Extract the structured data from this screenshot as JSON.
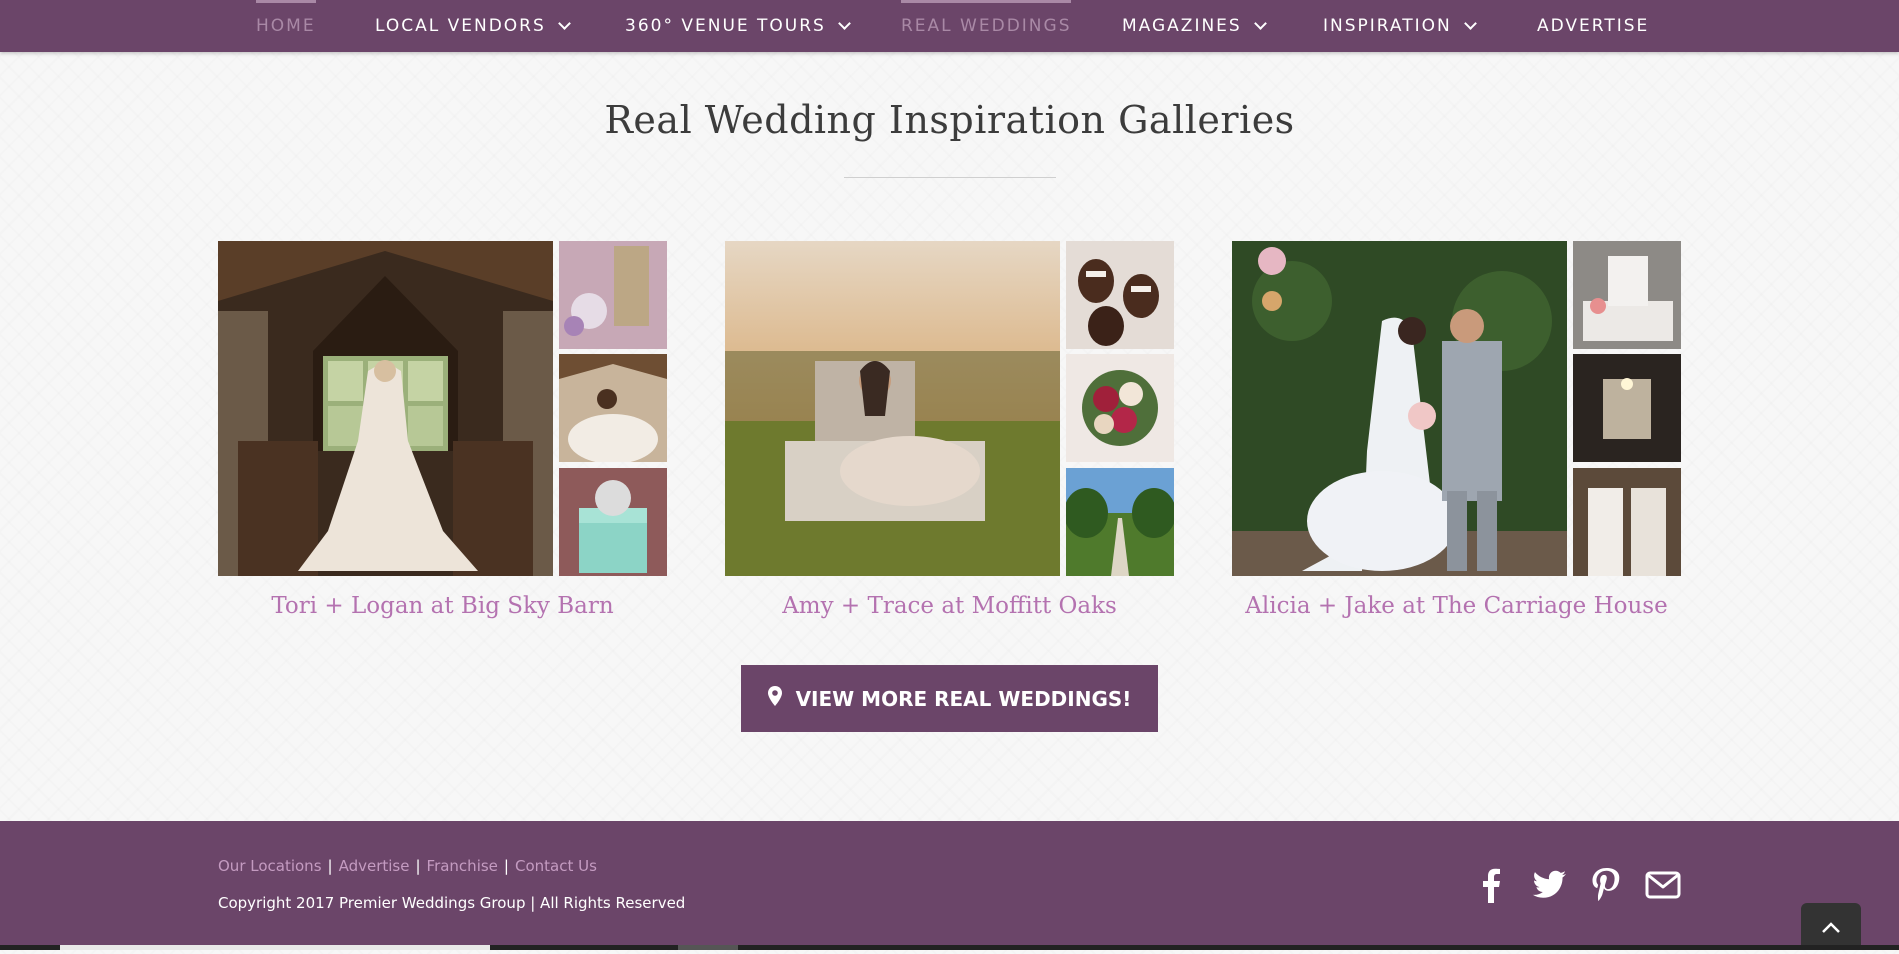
{
  "nav": {
    "items": [
      {
        "label": "HOME",
        "active": true,
        "dropdown": false
      },
      {
        "label": "LOCAL VENDORS",
        "active": false,
        "dropdown": true
      },
      {
        "label": "360° VENUE TOURS",
        "active": false,
        "dropdown": true
      },
      {
        "label": "REAL WEDDINGS",
        "active": true,
        "dropdown": false
      },
      {
        "label": "MAGAZINES",
        "active": false,
        "dropdown": true
      },
      {
        "label": "INSPIRATION",
        "active": false,
        "dropdown": true
      },
      {
        "label": "ADVERTISE",
        "active": false,
        "dropdown": false
      }
    ]
  },
  "section": {
    "title": "Real Wedding Inspiration Galleries"
  },
  "galleries": [
    {
      "title": "Tori + Logan at Big Sky Barn"
    },
    {
      "title": "Amy + Trace at Moffitt Oaks"
    },
    {
      "title": "Alicia + Jake at The Carriage House"
    }
  ],
  "cta": {
    "label": "VIEW MORE REAL WEDDINGS!",
    "icon": "map-pin-icon"
  },
  "footer": {
    "links": [
      "Our Locations",
      "Advertise",
      "Franchise",
      "Contact Us"
    ],
    "separator": "|",
    "copyright": "Copyright 2017 Premier Weddings Group | All Rights Reserved",
    "social": [
      "facebook-icon",
      "twitter-icon",
      "pinterest-icon",
      "envelope-icon"
    ]
  },
  "colors": {
    "brand": "#6b4569",
    "link": "#b472b0",
    "nav_active": "#a989a6"
  }
}
